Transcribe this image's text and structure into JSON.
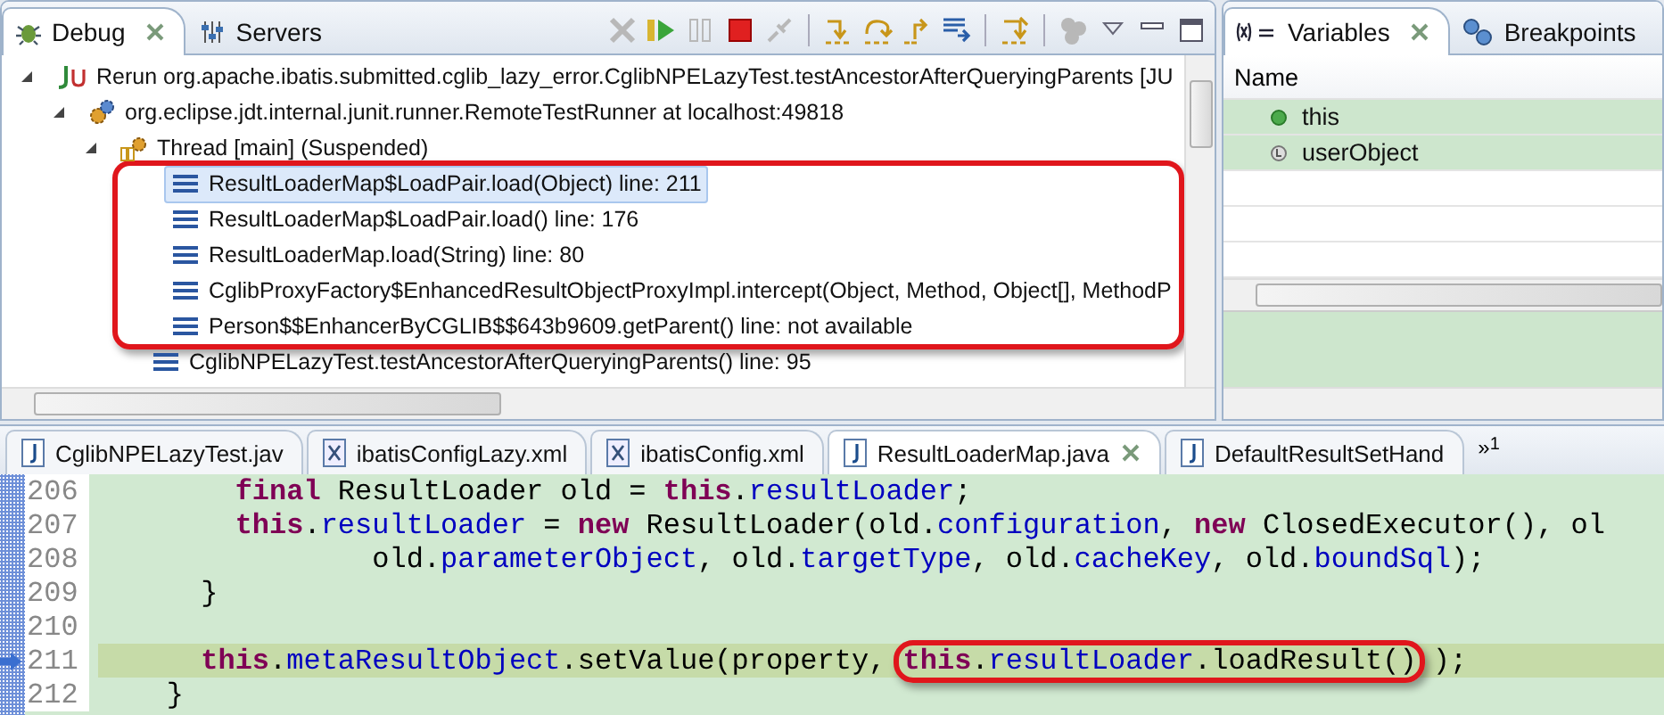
{
  "debug": {
    "tabs": [
      {
        "label": "Debug",
        "kind": "debug",
        "selected": true
      },
      {
        "label": "Servers",
        "kind": "servers",
        "selected": false
      }
    ],
    "toolbar": [
      {
        "kind": "remove",
        "disabled": true
      },
      {
        "kind": "resume",
        "disabled": false
      },
      {
        "kind": "suspend",
        "disabled": true
      },
      {
        "kind": "terminate",
        "disabled": false
      },
      {
        "kind": "disconnect",
        "disabled": true
      },
      {
        "kind": "separator"
      },
      {
        "kind": "step-into",
        "disabled": false
      },
      {
        "kind": "step-over",
        "disabled": false
      },
      {
        "kind": "step-return",
        "disabled": false
      },
      {
        "kind": "drop-to-frame",
        "disabled": false
      },
      {
        "kind": "separator"
      },
      {
        "kind": "step-filters",
        "disabled": false
      },
      {
        "kind": "separator"
      },
      {
        "kind": "instances",
        "disabled": true
      },
      {
        "kind": "view-menu",
        "disabled": false
      },
      {
        "kind": "minimize",
        "disabled": false
      },
      {
        "kind": "maximize",
        "disabled": false
      }
    ],
    "tree": [
      {
        "kind": "launch",
        "label": "Rerun org.apache.ibatis.submitted.cglib_lazy_error.CglibNPELazyTest.testAncestorAfterQueryingParents [JU",
        "expanded": true,
        "selected": false,
        "children": [
          {
            "kind": "target",
            "label": "org.eclipse.jdt.internal.junit.runner.RemoteTestRunner at localhost:49818",
            "expanded": true,
            "selected": false,
            "children": [
              {
                "kind": "thread",
                "label": "Thread [main] (Suspended)",
                "expanded": true,
                "selected": false,
                "children": [
                  {
                    "kind": "frame",
                    "label": "ResultLoaderMap$LoadPair.load(Object) line: 211",
                    "selected": true,
                    "circled": true
                  },
                  {
                    "kind": "frame",
                    "label": "ResultLoaderMap$LoadPair.load() line: 176",
                    "selected": false,
                    "circled": true
                  },
                  {
                    "kind": "frame",
                    "label": "ResultLoaderMap.load(String) line: 80",
                    "selected": false,
                    "circled": true
                  },
                  {
                    "kind": "frame",
                    "label": "CglibProxyFactory$EnhancedResultObjectProxyImpl.intercept(Object, Method, Object[], MethodP",
                    "selected": false,
                    "circled": true
                  },
                  {
                    "kind": "frame",
                    "label": "Person$$EnhancerByCGLIB$$643b9609.getParent() line: not available",
                    "selected": false,
                    "circled": true
                  },
                  {
                    "kind": "frame",
                    "label": "CglibNPELazyTest.testAncestorAfterQueryingParents() line: 95",
                    "selected": false,
                    "circled": false
                  }
                ]
              }
            ]
          }
        ]
      }
    ]
  },
  "variables": {
    "tabs": [
      {
        "label": "Variables",
        "kind": "variables",
        "selected": true
      },
      {
        "label": "Breakpoints",
        "kind": "breakpoints",
        "selected": false
      }
    ],
    "column": "Name",
    "rows": [
      {
        "name": "this",
        "kind": "field"
      },
      {
        "name": "userObject",
        "kind": "local"
      }
    ]
  },
  "editor": {
    "tabs": [
      {
        "label": "CglibNPELazyTest.jav",
        "kind": "java",
        "selected": false
      },
      {
        "label": "ibatisConfigLazy.xml",
        "kind": "xml",
        "selected": false
      },
      {
        "label": "ibatisConfig.xml",
        "kind": "xml",
        "selected": false
      },
      {
        "label": "ResultLoaderMap.java",
        "kind": "java",
        "selected": true
      },
      {
        "label": "DefaultResultSetHand",
        "kind": "java",
        "selected": false
      }
    ],
    "overflow": {
      "label": "»",
      "count": "1"
    },
    "lines": [
      {
        "number": "206",
        "current": false,
        "segments": [
          {
            "kind": "keyword",
            "text": "        final"
          },
          {
            "kind": "plain",
            "text": " ResultLoader old = "
          },
          {
            "kind": "keyword",
            "text": "this"
          },
          {
            "kind": "plain",
            "text": "."
          },
          {
            "kind": "field",
            "text": "resultLoader"
          },
          {
            "kind": "plain",
            "text": ";"
          }
        ]
      },
      {
        "number": "207",
        "current": false,
        "segments": [
          {
            "kind": "keyword",
            "text": "        this"
          },
          {
            "kind": "plain",
            "text": "."
          },
          {
            "kind": "field",
            "text": "resultLoader"
          },
          {
            "kind": "plain",
            "text": " = "
          },
          {
            "kind": "keyword",
            "text": "new"
          },
          {
            "kind": "plain",
            "text": " ResultLoader(old."
          },
          {
            "kind": "field",
            "text": "configuration"
          },
          {
            "kind": "plain",
            "text": ", "
          },
          {
            "kind": "keyword",
            "text": "new"
          },
          {
            "kind": "plain",
            "text": " ClosedExecutor(), ol"
          }
        ]
      },
      {
        "number": "208",
        "current": false,
        "segments": [
          {
            "kind": "plain",
            "text": "                old."
          },
          {
            "kind": "field",
            "text": "parameterObject"
          },
          {
            "kind": "plain",
            "text": ", old."
          },
          {
            "kind": "field",
            "text": "targetType"
          },
          {
            "kind": "plain",
            "text": ", old."
          },
          {
            "kind": "field",
            "text": "cacheKey"
          },
          {
            "kind": "plain",
            "text": ", old."
          },
          {
            "kind": "field",
            "text": "boundSql"
          },
          {
            "kind": "plain",
            "text": ");"
          }
        ]
      },
      {
        "number": "209",
        "current": false,
        "segments": [
          {
            "kind": "plain",
            "text": "      }"
          }
        ]
      },
      {
        "number": "210",
        "current": false
      },
      {
        "number": "211",
        "current": true,
        "segments": [
          {
            "kind": "keyword",
            "text": "      this"
          },
          {
            "kind": "plain",
            "text": "."
          },
          {
            "kind": "field",
            "text": "metaResultObject"
          },
          {
            "kind": "plain",
            "text": ".setValue(property, "
          },
          {
            "kind": "circled",
            "parts": [
              {
                "kind": "keyword",
                "text": "this"
              },
              {
                "kind": "plain",
                "text": "."
              },
              {
                "kind": "field",
                "text": "resultLoader"
              },
              {
                "kind": "plain",
                "text": ".loadResult()"
              }
            ]
          },
          {
            "kind": "plain",
            "text": ");"
          }
        ]
      },
      {
        "number": "212",
        "current": false,
        "segments": [
          {
            "kind": "plain",
            "text": "    }"
          }
        ]
      }
    ]
  }
}
